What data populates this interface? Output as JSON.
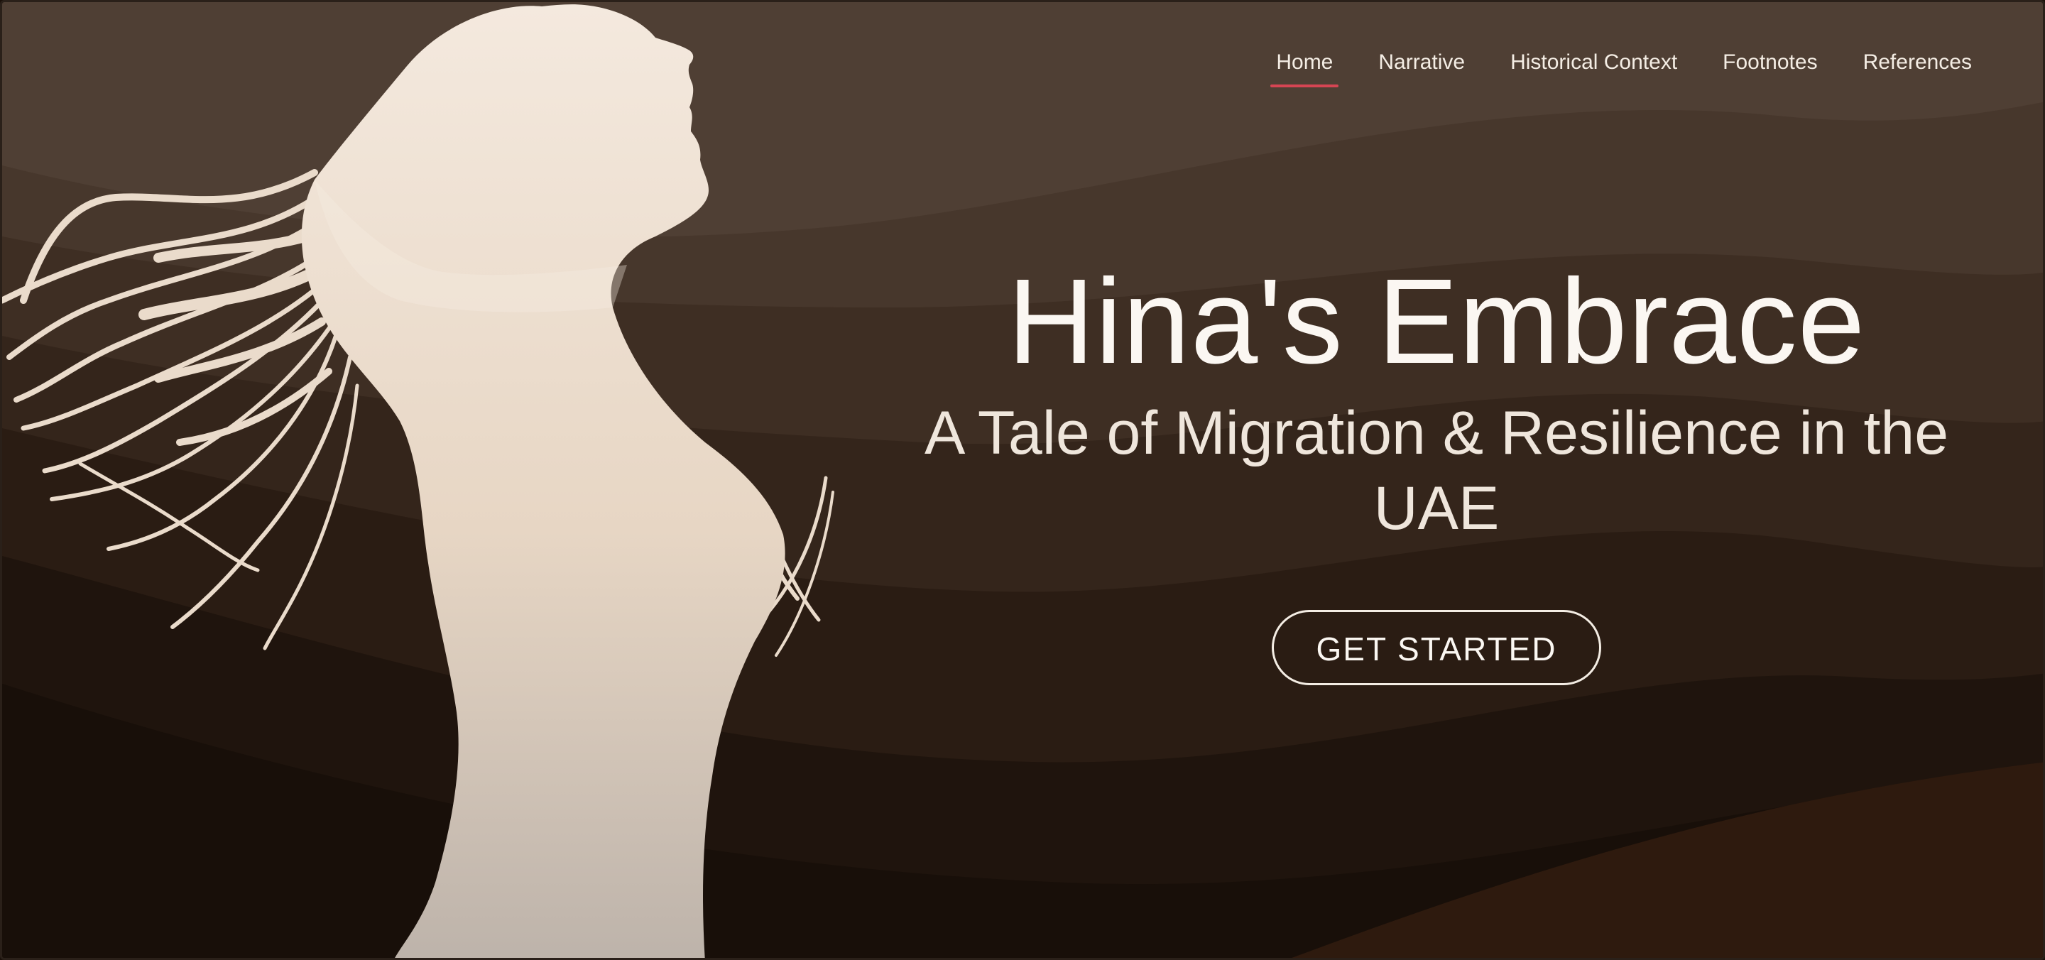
{
  "nav": {
    "items": [
      {
        "label": "Home",
        "active": true
      },
      {
        "label": "Narrative",
        "active": false
      },
      {
        "label": "Historical Context",
        "active": false
      },
      {
        "label": "Footnotes",
        "active": false
      },
      {
        "label": "References",
        "active": false
      }
    ],
    "active_indicator_color": "#d64553"
  },
  "hero": {
    "title": "Hina's Embrace",
    "subtitle": "A Tale of Migration & Resilience in the UAE",
    "cta_label": "GET STARTED",
    "illustration": "woman-silhouette-with-windblown-hair",
    "background": "layered-brown-desert-dunes",
    "colors": {
      "sky": "#4f3f34",
      "dune_dark": "#140c07",
      "silhouette": "#f2e6da",
      "text": "#fbf7f2"
    }
  }
}
